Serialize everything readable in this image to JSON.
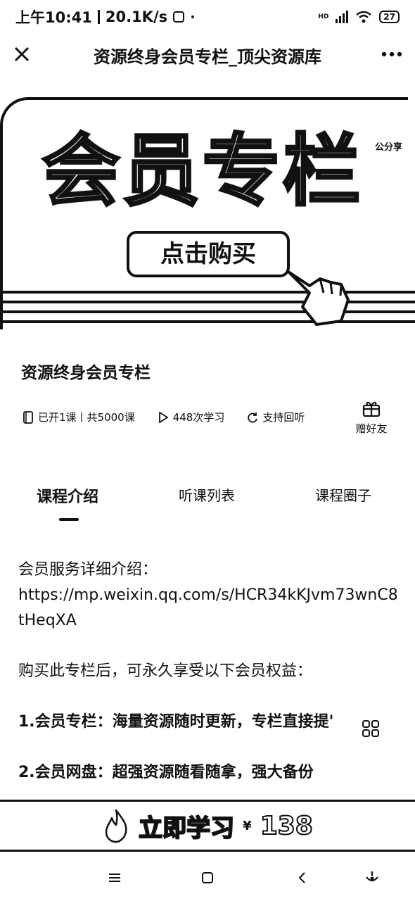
{
  "status_bar": {
    "time": "上午10:41",
    "speed": "20.1K/s",
    "dot": "·",
    "hd": "HD",
    "battery": "27"
  },
  "titlebar": {
    "close_icon": "close-icon",
    "title": "资源终身会员专栏_顶尖资源库",
    "more_icon": "more-icon"
  },
  "banner": {
    "headline": "会员专栏",
    "share_label": "公分享",
    "buy_button": "点击购买",
    "hand_icon": "pointing-hand-icon"
  },
  "course": {
    "title": "资源终身会员专栏",
    "lessons": "已开1课丨共5000课",
    "plays": "448次学习",
    "replay": "支持回听",
    "gift": "赠好友"
  },
  "tabs": [
    {
      "label": "课程介绍",
      "active": true
    },
    {
      "label": "听课列表",
      "active": false
    },
    {
      "label": "课程圈子",
      "active": false
    }
  ],
  "content": {
    "intro_label": "会员服务详细介绍：",
    "url": "https://mp.weixin.qq.com/s/HCR34kKJvm73wnC8tHeqXA",
    "benefits_intro": "购买此专栏后，可永久享受以下会员权益：",
    "benefit_1": "1.会员专栏：海量资源随时更新，专栏直接提'",
    "benefit_2": "2.会员网盘：超强资源随看随拿，强大备份"
  },
  "learn_bar": {
    "label": "立即学习",
    "currency": "¥",
    "price": "138"
  },
  "nav": {
    "menu_icon": "menu-icon",
    "home_icon": "home-icon",
    "back_icon": "back-icon",
    "assistant_icon": "assistant-icon"
  }
}
